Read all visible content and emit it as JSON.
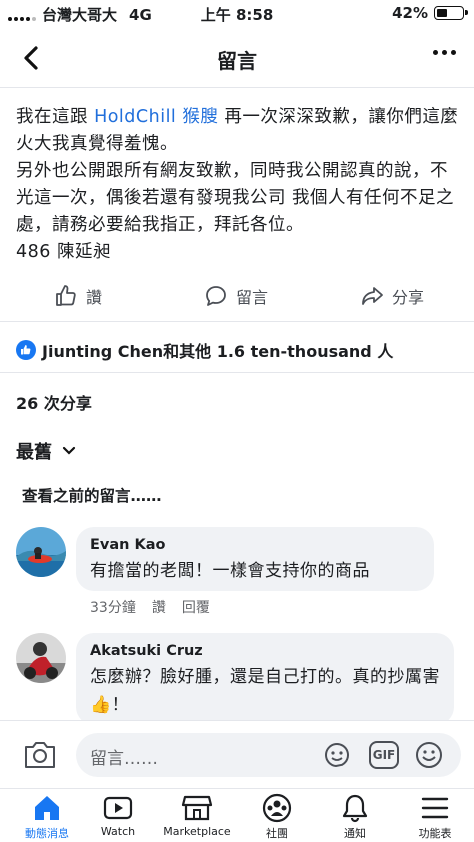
{
  "status_bar": {
    "carrier": "台灣大哥大",
    "network": "4G",
    "time": "上午 8:58",
    "battery": "42%",
    "battery_level": 0.42
  },
  "header": {
    "title": "留言"
  },
  "post": {
    "text_before_link": "我在這跟 ",
    "link_text": "HoldChill 猴膄",
    "text_after_link": " 再一次深深致歉，讓你們這麼火大我真覺得羞愧。",
    "line2": "另外也公開跟所有網友致歉，同時我公開認真的說，不光這一次，偶後若還有發現我公司 我個人有任何不足之處，請務必要給我指正，拜託各位。",
    "line3": "486 陳延昶"
  },
  "actions": {
    "like": "讚",
    "comment": "留言",
    "share": "分享"
  },
  "reactions": {
    "text": "Jiunting Chen和其他 1.6 ten-thousand 人"
  },
  "shares": {
    "text": "26 次分享"
  },
  "sort": {
    "label": "最舊"
  },
  "previous_comments": {
    "label": "查看之前的留言……"
  },
  "comments": [
    {
      "name": "Evan Kao",
      "text": "有擔當的老闆！一樣會支持你的商品",
      "time": "33分鐘",
      "like": "讚",
      "reply": "回覆"
    },
    {
      "name": "Akatsuki Cruz",
      "text": "怎麼辦？臉好腫，還是自己打的。真的抄厲害👍！"
    }
  ],
  "composer": {
    "placeholder": "留言……",
    "gif_label": "GIF"
  },
  "tabs": [
    {
      "label": "動態消息",
      "icon": "home-icon",
      "active": true
    },
    {
      "label": "Watch",
      "icon": "watch-icon",
      "active": false
    },
    {
      "label": "Marketplace",
      "icon": "marketplace-icon",
      "active": false
    },
    {
      "label": "社團",
      "icon": "groups-icon",
      "active": false
    },
    {
      "label": "通知",
      "icon": "bell-icon",
      "active": false
    },
    {
      "label": "功能表",
      "icon": "menu-icon",
      "active": false
    }
  ],
  "colors": {
    "accent": "#1877f2",
    "link": "#216fdb",
    "bubble": "#f0f2f5",
    "muted": "#65676b"
  }
}
